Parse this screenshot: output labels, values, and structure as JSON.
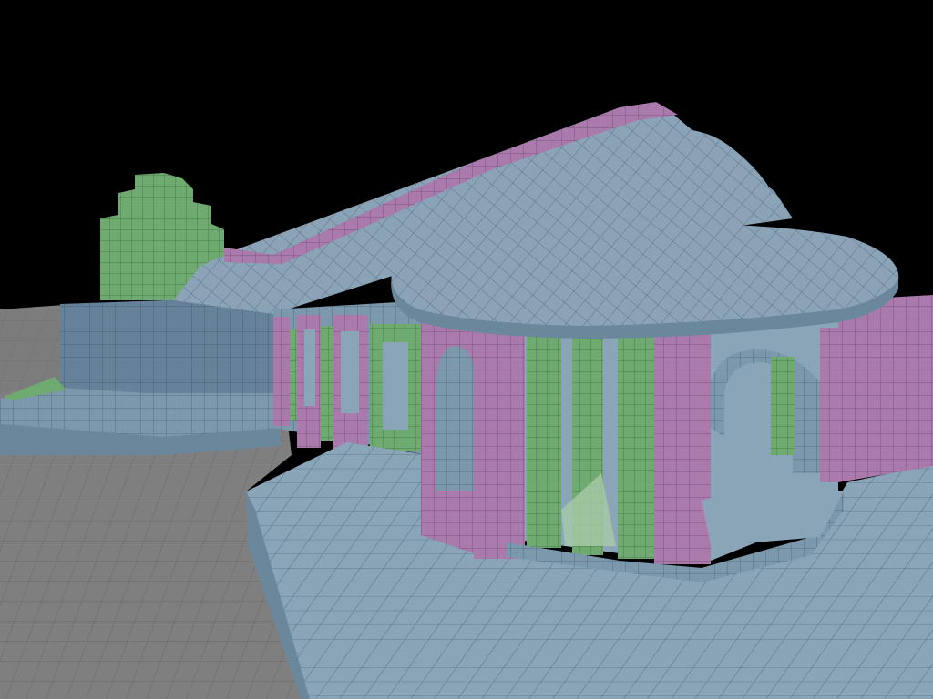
{
  "scene": {
    "colors": {
      "sky": "#000000",
      "ground": "#7f7f7f",
      "stone": "#7b98ad",
      "stone_dark": "#5f7b8f",
      "stone_light": "#9db3c4",
      "magenta": "#a478a6",
      "green": "#6fa870",
      "pale_green": "#a9c9a8",
      "grid_line": "#3e4e5a"
    }
  }
}
